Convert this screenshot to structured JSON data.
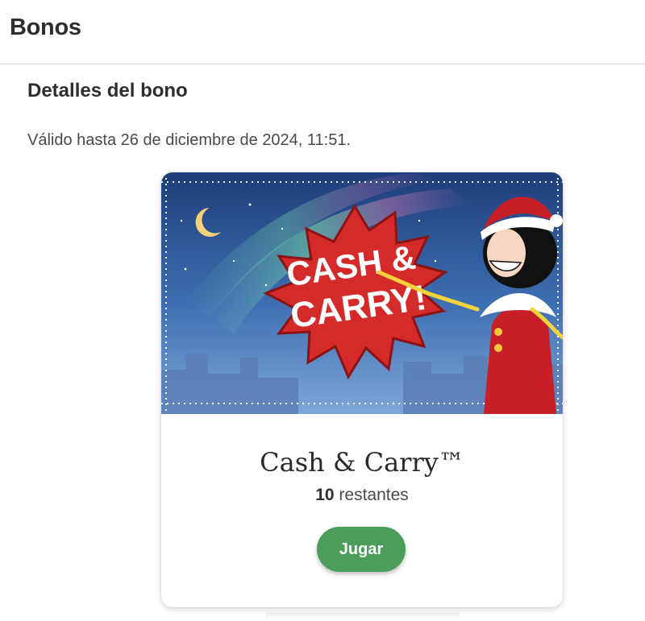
{
  "header": {
    "title": "Bonos"
  },
  "details": {
    "title": "Detalles del bono",
    "validity": "Válido hasta 26 de diciembre de 2024, 11:51."
  },
  "bonus_card": {
    "banner_logo_line1": "CASH &",
    "banner_logo_line2": "CARRY!",
    "game_title": "Cash & Carry™",
    "remaining_count": "10",
    "remaining_label": " restantes",
    "play_label": "Jugar"
  },
  "colors": {
    "accent_green": "#4a9e59",
    "banner_sky": "#3f6fb3",
    "starburst_red": "#d42a2a"
  }
}
